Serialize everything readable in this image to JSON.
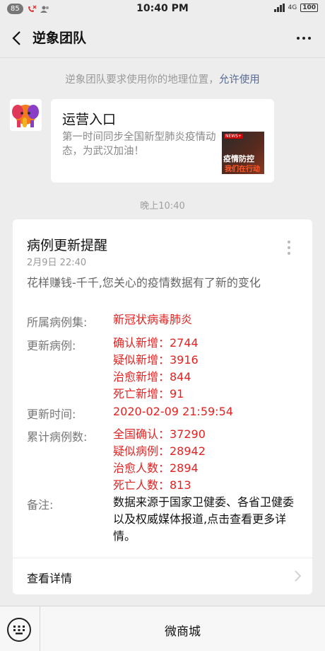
{
  "status_bar": {
    "badge": "85",
    "time": "10:40 PM",
    "network": "4G",
    "battery": "100"
  },
  "header": {
    "title": "逆象团队",
    "back_icon": "back-arrow-icon",
    "more_icon": "more-horizontal-icon"
  },
  "notice": {
    "text": "逆象团队要求使用你的地理位置，",
    "link": "允许使用"
  },
  "first_message": {
    "title": "运营入口",
    "description": "第一时间同步全国新型肺炎疫情动态，为武汉加油！",
    "thumb_tag": "NEWS+",
    "thumb_line1": "疫情防控",
    "thumb_line2": "我们在行动"
  },
  "time_divider": "晚上10:40",
  "update_card": {
    "title": "病例更新提醒",
    "date": "2月9日  22:40",
    "intro": "花样赚钱-千千,您关心的疫情数据有了新的变化",
    "dataset_label": "所属病例集:",
    "dataset_value": "新冠状病毒肺炎",
    "update_label": "更新病例:",
    "updates": [
      "确认新增：2744",
      "疑似新增：3916",
      "治愈新增：844",
      "死亡新增：91"
    ],
    "time_label": "更新时间:",
    "time_value": "2020-02-09 21:59:54",
    "total_label": "累计病例数:",
    "totals": [
      "全国确认：37290",
      "疑似病例：28942",
      "治愈人数：2894",
      "死亡人数：813"
    ],
    "note_label": "备注:",
    "note_value": "数据来源于国家卫健委、各省卫健委以及权威媒体报道,点击查看更多详情。",
    "footer": "查看详情"
  },
  "bottom_bar": {
    "menu_label": "微商城"
  },
  "colors": {
    "background": "#ededed",
    "highlight_red": "#e52222",
    "link_blue": "#576b95"
  }
}
